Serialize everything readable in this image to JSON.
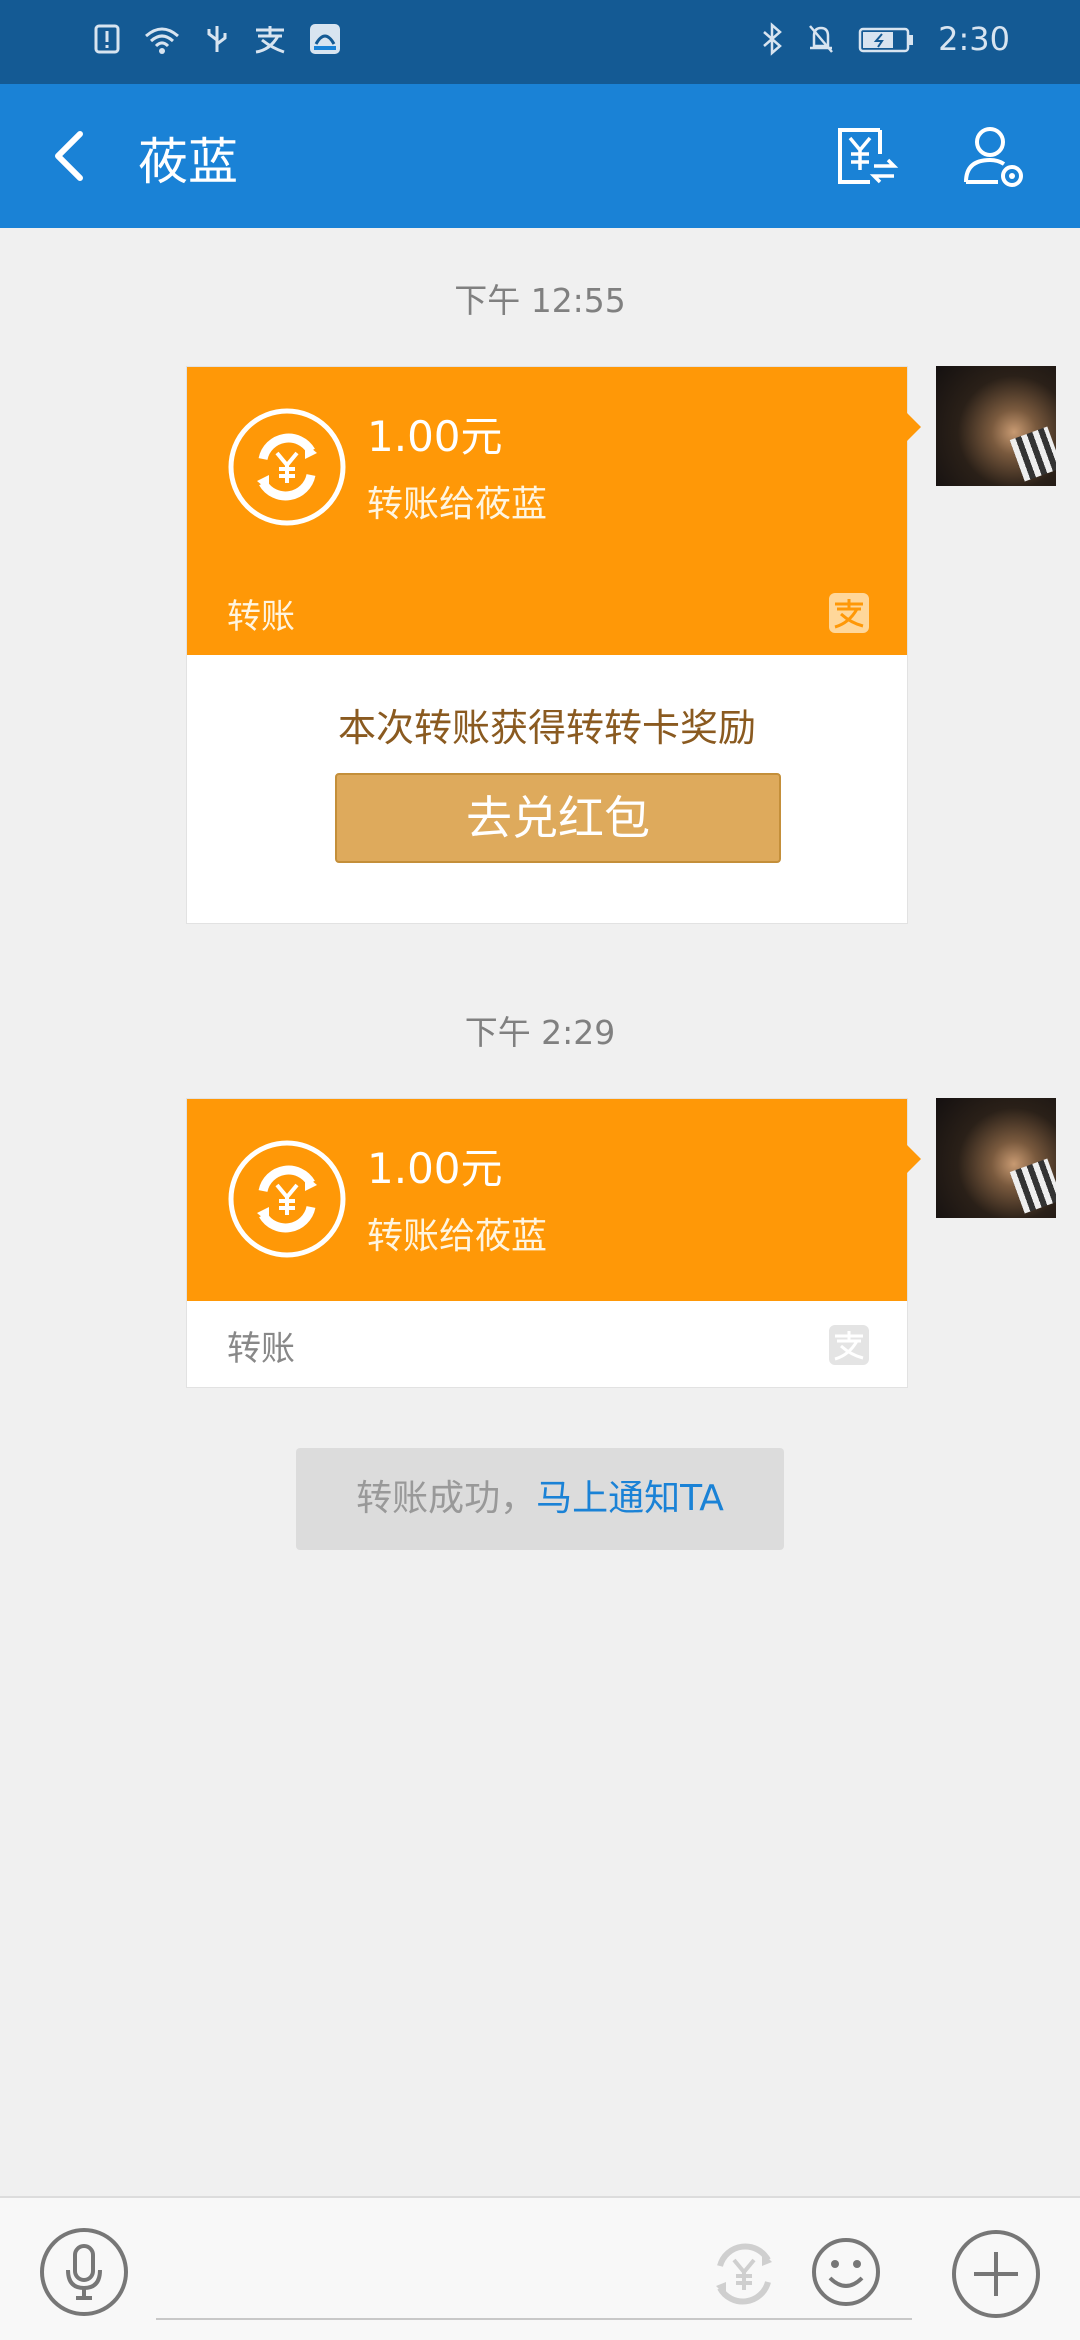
{
  "status_bar": {
    "time": "2:30",
    "left_icons": [
      "alert-icon",
      "wifi-icon",
      "usb-icon",
      "alipay-icon",
      "app-badge-icon"
    ],
    "right_icons": [
      "bluetooth-icon",
      "mute-icon",
      "battery-icon"
    ]
  },
  "header": {
    "title": "莜蓝",
    "icons": [
      "back-icon",
      "transfer-icon",
      "user-settings-icon"
    ]
  },
  "messages": [
    {
      "timestamp": "下午 12:55",
      "amount": "1.00元",
      "to_label": "转账给莜蓝",
      "type_label": "转账",
      "reward_text": "本次转账获得转转卡奖励",
      "redeem_button": "去兑红包"
    },
    {
      "timestamp": "下午 2:29",
      "amount": "1.00元",
      "to_label": "转账给莜蓝",
      "type_label": "转账"
    }
  ],
  "notice": {
    "prefix": "转账成功，",
    "link": "马上通知TA"
  },
  "bottom_bar": {
    "icons": [
      "microphone-icon",
      "yuan-transfer-icon",
      "emoji-icon",
      "plus-icon"
    ]
  },
  "colors": {
    "status_bar": "#145a94",
    "nav_bar": "#1a82d6",
    "transfer_card": "#ff9807",
    "redeem_button": "#deaa5c",
    "link": "#1a82d6"
  }
}
